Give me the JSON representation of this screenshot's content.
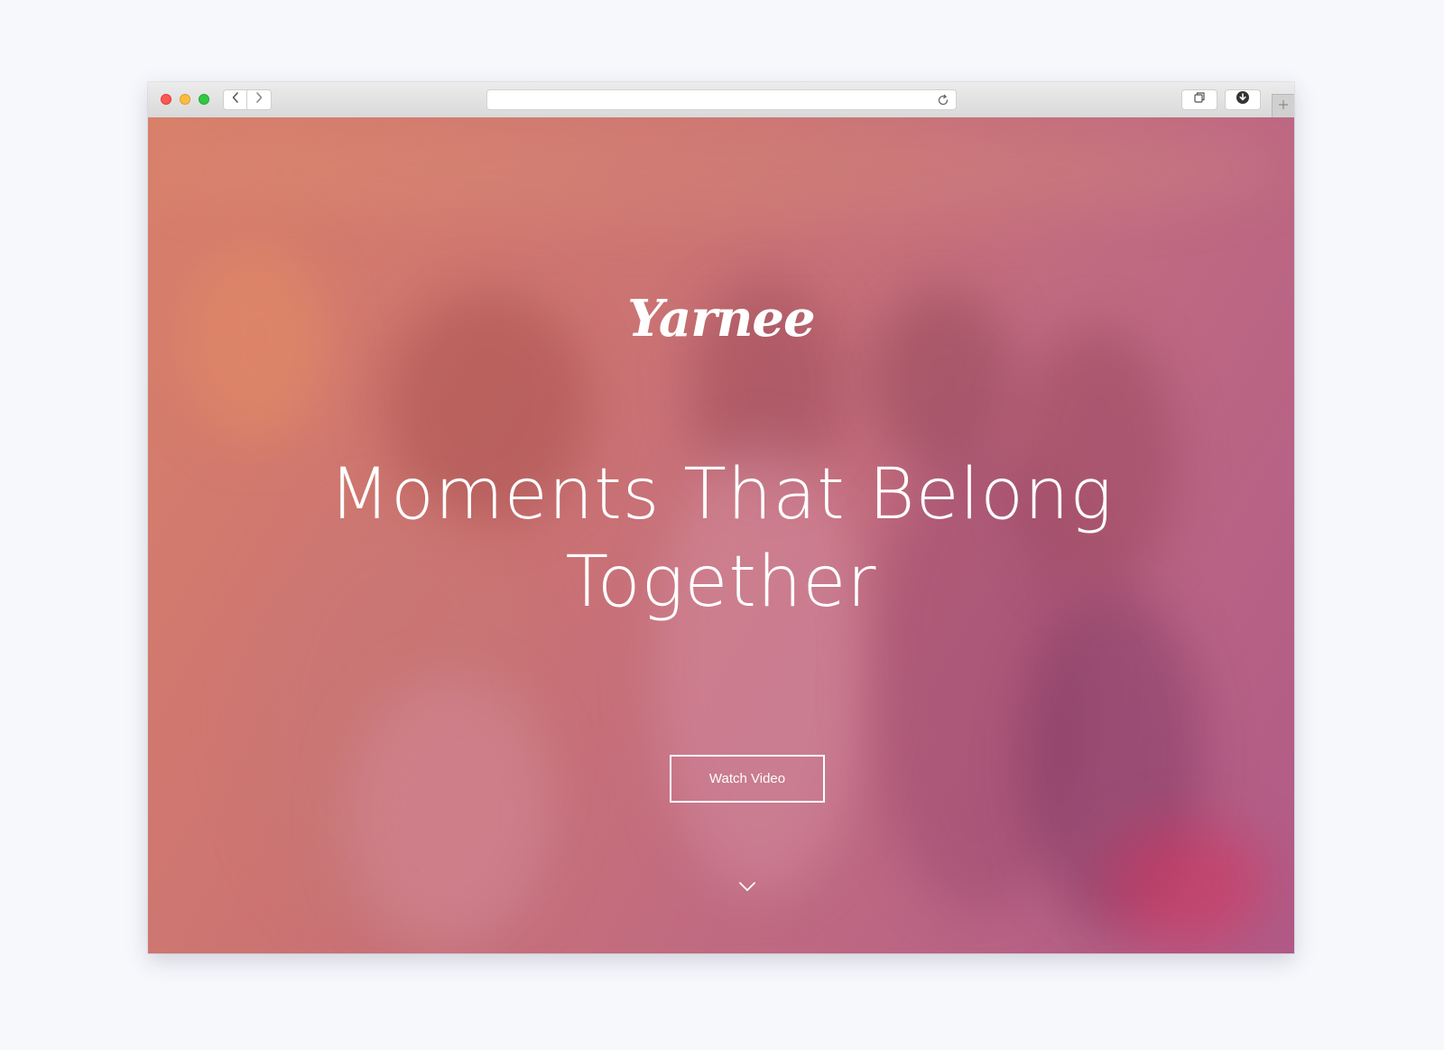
{
  "browser": {
    "traffic_lights": {
      "close_color": "#fc5753",
      "minimize_color": "#fdbc40",
      "maximize_color": "#33c748"
    },
    "nav": {
      "back_icon": "chevron-left-icon",
      "forward_icon": "chevron-right-icon"
    },
    "address_bar": {
      "value": "",
      "reload_icon": "reload-icon"
    },
    "toolbar_icons": [
      "tabs-overview-icon",
      "download-icon",
      "plus-icon"
    ]
  },
  "hero": {
    "logo": "Yarnee",
    "headline_line1": "Moments That Belong",
    "headline_line2": "Together",
    "cta_label": "Watch Video",
    "scroll_icon": "chevron-down-icon",
    "overlay_colors": [
      "#d8806a",
      "#cc7472",
      "#c06a82",
      "#b05a88"
    ],
    "text_color": "#ffffff"
  }
}
